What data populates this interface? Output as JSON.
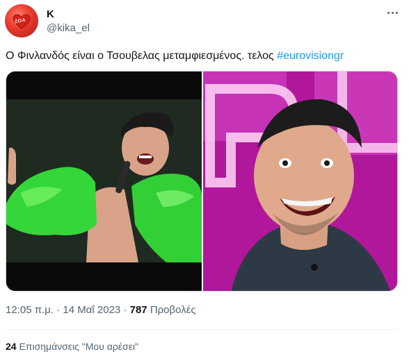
{
  "author": {
    "display_name": "K",
    "handle": "@kika_el",
    "avatar_text": "ZOA"
  },
  "tweet": {
    "text": "Ο Φινλανδός είναι ο Τσουβελας μεταμφιεσμένος. τελος ",
    "hashtag": "#eurovisiongr"
  },
  "meta": {
    "time": "12:05 π.μ.",
    "separator": " · ",
    "date": "14 Μαΐ 2023",
    "views_count": "787",
    "views_label": "Προβολές"
  },
  "engagement": {
    "likes_count": "24",
    "likes_label": "Επισημάνσεις \"Μου αρέσει\""
  },
  "media": {
    "left_image": "performer-in-green-jacket-photo",
    "right_image": "laughing-man-pink-background-photo"
  },
  "colors": {
    "text": "#0f1419",
    "secondary": "#536471",
    "link": "#1d9bf0",
    "accent_green": "#3fe03a",
    "accent_pink": "#c11aa8"
  }
}
